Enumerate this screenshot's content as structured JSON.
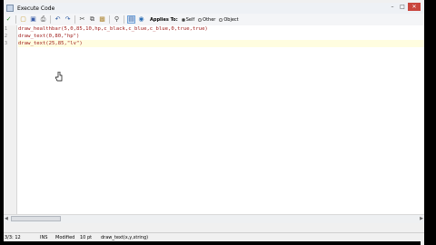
{
  "window": {
    "title": "Execute Code"
  },
  "toolbar": {
    "icons": [
      "check-icon",
      "open-icon",
      "save-icon",
      "print-icon",
      "undo-icon",
      "redo-icon",
      "cut-icon",
      "copy-icon",
      "paste-icon",
      "search-icon",
      "code-icon",
      "globe-icon"
    ],
    "applies_to_label": "Applies To:",
    "options": [
      "Self",
      "Other",
      "Object"
    ],
    "selected_option": "Self"
  },
  "editor": {
    "line_numbers": [
      "1",
      "2",
      "3"
    ],
    "lines": [
      "draw_healthbar(5,0,85,10,hp,c_black,c_blue,c_blue,0,true,true)",
      "draw_text(0,80,\"hp\")",
      "draw_text(25,85,\"lv\")"
    ],
    "current_line": 3
  },
  "status": {
    "position": "3/3: 12",
    "mode": "INS",
    "state": "Modified",
    "font_size": "10 pt",
    "hint": "draw_text(x,y,string)"
  }
}
